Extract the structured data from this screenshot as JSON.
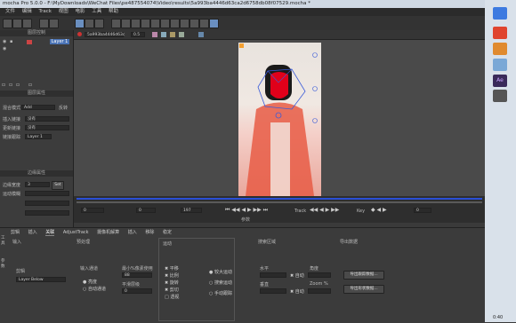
{
  "window": {
    "title": "mocha Pro 5.0.0 - F:\\MyDownloads\\WeChat Files\\pe487554074\\Video\\results\\5a993ba4446d63ca2d6758db08f07529.mocha *"
  },
  "menu": [
    "文件",
    "编辑",
    "Track",
    "视图",
    "电影",
    "工具",
    "帮助"
  ],
  "layers_panel": {
    "title": "图层控制",
    "layer_name": "Layer 1",
    "props_title": "图层属性",
    "blend_label": "混合模式",
    "blend_value": "Add",
    "invert_label": "反转",
    "link_in_label": "插入链接",
    "link_in_value": "没有",
    "link_out_label": "更新链接",
    "link_out_value": "没有",
    "link_to_label": "链接跟踪",
    "link_to_value": "Layer 1",
    "edge_title": "边缘属性",
    "edge_width_label": "边缘宽度",
    "edge_width_value": "3",
    "edge_set_button": "Set",
    "edge_motion_label": "运动模糊"
  },
  "viewer": {
    "clip_name": "5a993ba4446d63c",
    "zoom_value": "0.5"
  },
  "timeline": {
    "frame_start": "0",
    "frame_current": "0",
    "frame_end": "197",
    "frame_value": "0",
    "track_label": "Track",
    "key_label": "Key",
    "params_label": "参数"
  },
  "bottom_tabs": [
    "剪辑",
    "插入",
    "关联",
    "AdjustTrack",
    "摄像机解算",
    "插入",
    "移除",
    "稳定"
  ],
  "side_tabs": [
    "工具",
    "参数"
  ],
  "track_panel": {
    "input_title": "输入",
    "preprocess_title": "预处理",
    "clip_label": "剪辑",
    "clip_value": "Layer Below",
    "channel_label": "输入通道",
    "channel_opt1": "亮度",
    "channel_opt2": "自动通道",
    "min_pixels_label": "最小%像素使用",
    "min_pixels_value": "88",
    "smooth_label": "平滑层级",
    "smooth_value": "0",
    "motion_title": "运动",
    "motion_items": [
      "平移",
      "比例",
      "旋转",
      "剪切",
      "透视"
    ],
    "motion_opts": [
      "较大运动",
      "搜索运动",
      "手动跟踪"
    ],
    "search_title": "搜索区域",
    "horiz_label": "水平",
    "vert_label": "垂直",
    "auto_label": "自动",
    "angle_label": "角度",
    "zoom_label": "Zoom %",
    "export_title": "导出数据",
    "export_btn1": "导出跟踪数据...",
    "export_btn2": "导出形状数据..."
  },
  "system": {
    "clock": "0:40"
  }
}
